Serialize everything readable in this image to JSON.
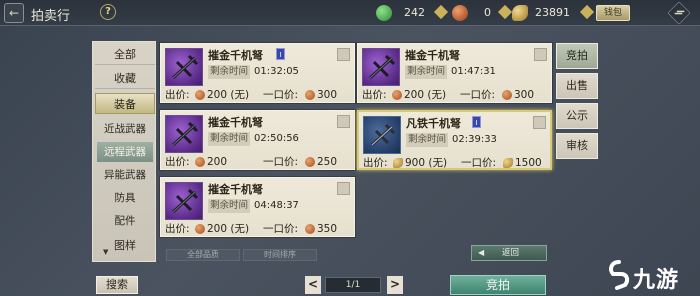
{
  "header": {
    "back_symbol": "←",
    "title": "拍卖行",
    "help_symbol": "?",
    "currencies": [
      {
        "name": "jade",
        "icon": "green-gem-icon",
        "value": "242",
        "color": "#4caf50"
      },
      {
        "name": "copper",
        "icon": "copper-coin-icon",
        "value": "0",
        "color": "#c4622d"
      },
      {
        "name": "gold",
        "icon": "gold-ingot-icon",
        "value": "23891",
        "color": "#c8a24a"
      }
    ],
    "wallet_label": "钱包"
  },
  "nav": {
    "items": [
      {
        "label": "全部"
      },
      {
        "label": "收藏"
      },
      {
        "label": "装备"
      }
    ],
    "subitems": [
      {
        "label": "近战武器"
      },
      {
        "label": "远程武器"
      },
      {
        "label": "异能武器"
      },
      {
        "label": "防具"
      },
      {
        "label": "配件"
      }
    ],
    "last_item": {
      "label": "图样",
      "chevron": "▼"
    }
  },
  "listings": [
    {
      "name": "摧金千机弩",
      "badge": "I",
      "time_label": "剩余时间",
      "time": "01:32:05",
      "bid_label": "出价:",
      "bid": "200 (无)",
      "buyout_label": "一口价:",
      "buyout": "300",
      "rarity": "purple"
    },
    {
      "name": "摧金千机弩",
      "badge": "",
      "time_label": "剩余时间",
      "time": "01:47:31",
      "bid_label": "出价:",
      "bid": "200 (无)",
      "buyout_label": "一口价:",
      "buyout": "300",
      "rarity": "purple"
    },
    {
      "name": "摧金千机弩",
      "badge": "",
      "time_label": "剩余时间",
      "time": "02:50:56",
      "bid_label": "出价:",
      "bid": "200",
      "buyout_label": "一口价:",
      "buyout": "250",
      "rarity": "purple"
    },
    {
      "name": "凡铁千机弩",
      "badge": "I",
      "time_label": "剩余时间",
      "time": "02:39:33",
      "bid_label": "出价:",
      "bid": "900 (无)",
      "buyout_label": "一口价:",
      "buyout": "1500",
      "rarity": "blue"
    },
    {
      "name": "摧金千机弩",
      "badge": "",
      "time_label": "剩余时间",
      "time": "04:48:37",
      "bid_label": "出价:",
      "bid": "200 (无)",
      "buyout_label": "一口价:",
      "buyout": "350",
      "rarity": "purple"
    }
  ],
  "right_tabs": [
    {
      "label": "竞拍"
    },
    {
      "label": "出售"
    },
    {
      "label": "公示"
    },
    {
      "label": "审核"
    }
  ],
  "filters": {
    "quality": "全部品质",
    "sort": "时间排序"
  },
  "return_button": {
    "arrow": "◀",
    "label": "返回"
  },
  "bottom": {
    "search_label": "搜索",
    "prev": "<",
    "next": ">",
    "page": "1/1",
    "bid_label": "竞拍"
  },
  "logo": {
    "text": "九游"
  }
}
